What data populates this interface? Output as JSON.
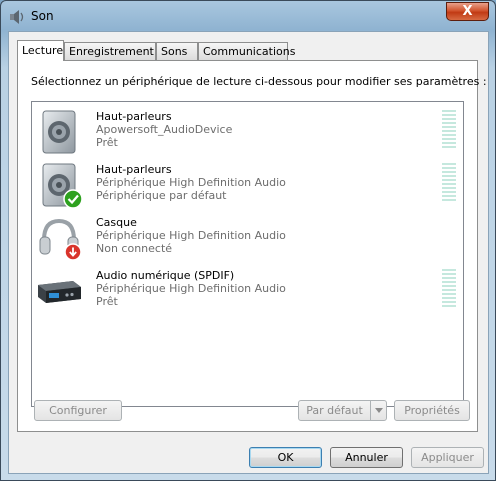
{
  "window": {
    "title": "Son",
    "close_label": "X"
  },
  "tabs": [
    {
      "label": "Lecture",
      "active": true
    },
    {
      "label": "Enregistrement",
      "active": false
    },
    {
      "label": "Sons",
      "active": false
    },
    {
      "label": "Communications",
      "active": false
    }
  ],
  "instructions": "Sélectionnez un périphérique de lecture ci-dessous pour modifier ses paramètres :",
  "devices": [
    {
      "name": "Haut-parleurs",
      "description": "Apowersoft_AudioDevice",
      "status": "Prêt",
      "icon": "speaker-icon",
      "meter_level": 0
    },
    {
      "name": "Haut-parleurs",
      "description": "Périphérique High Definition Audio",
      "status": "Périphérique par défaut",
      "icon": "speaker-default-icon",
      "meter_level": 0
    },
    {
      "name": "Casque",
      "description": "Périphérique High Definition Audio",
      "status": "Non connecté",
      "icon": "headphones-icon",
      "meter_level": null
    },
    {
      "name": "Audio numérique (SPDIF)",
      "description": "Périphérique High Definition Audio",
      "status": "Prêt",
      "icon": "spdif-device-icon",
      "meter_level": 0
    }
  ],
  "panel_buttons": {
    "configure": "Configurer",
    "set_default": "Par défaut",
    "properties": "Propriétés"
  },
  "dialog_buttons": {
    "ok": "OK",
    "cancel": "Annuler",
    "apply": "Appliquer"
  },
  "colors": {
    "meter_idle": "#c5e8de",
    "default_check": "#2ea11f",
    "disconnected_badge": "#d9342b"
  }
}
